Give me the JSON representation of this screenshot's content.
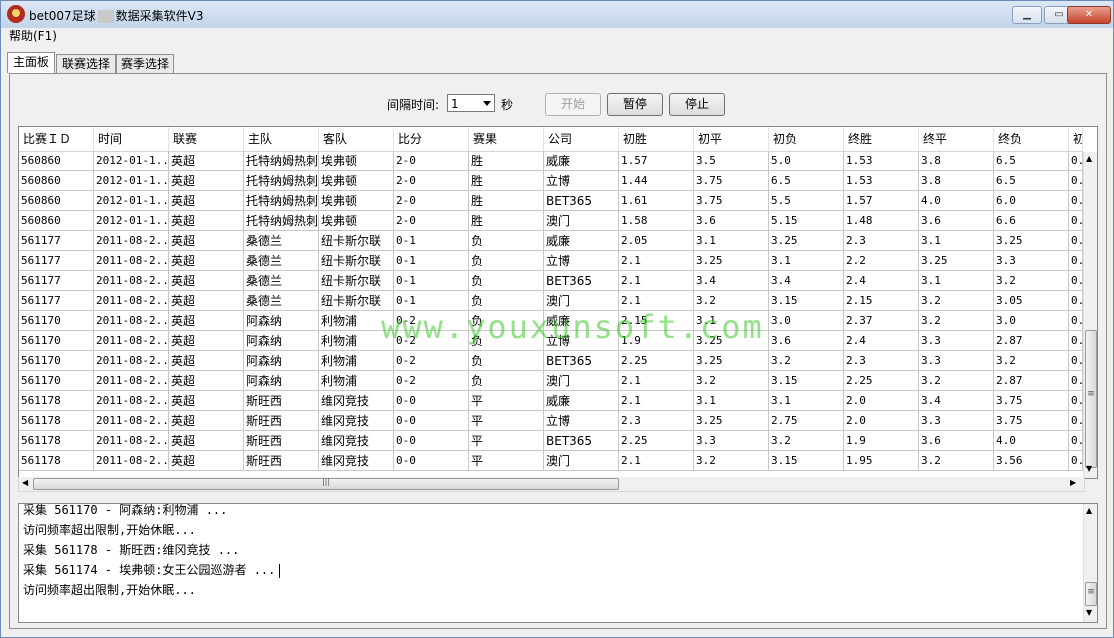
{
  "window": {
    "title_left": "bet007足球",
    "title_right": "数据采集软件V3",
    "btn_min": "▁",
    "btn_max": "▭",
    "btn_close": "✕"
  },
  "menu": {
    "help": "帮助(F1)"
  },
  "tabs": [
    {
      "label": "主面板",
      "active": true
    },
    {
      "label": "联赛选择",
      "active": false
    },
    {
      "label": "赛季选择",
      "active": false
    }
  ],
  "controls": {
    "interval_label": "间隔时间:",
    "interval_value": "1",
    "unit": "秒",
    "start": "开始",
    "pause": "暂停",
    "stop": "停止"
  },
  "table": {
    "columns": [
      "比赛ＩＤ",
      "时间",
      "联赛",
      "主队",
      "客队",
      "比分",
      "赛果",
      "公司",
      "初胜",
      "初平",
      "初负",
      "终胜",
      "终平",
      "终负",
      "初"
    ],
    "rows": [
      [
        "560860",
        "2012-01-1...",
        "英超",
        "托特纳姆热刺",
        "埃弗顿",
        "2-0",
        "胜",
        "威廉",
        "1.57",
        "3.5",
        "5.0",
        "1.53",
        "3.8",
        "6.5",
        "0."
      ],
      [
        "560860",
        "2012-01-1...",
        "英超",
        "托特纳姆热刺",
        "埃弗顿",
        "2-0",
        "胜",
        "立博",
        "1.44",
        "3.75",
        "6.5",
        "1.53",
        "3.8",
        "6.5",
        "0."
      ],
      [
        "560860",
        "2012-01-1...",
        "英超",
        "托特纳姆热刺",
        "埃弗顿",
        "2-0",
        "胜",
        "BET365",
        "1.61",
        "3.75",
        "5.5",
        "1.57",
        "4.0",
        "6.0",
        "0."
      ],
      [
        "560860",
        "2012-01-1...",
        "英超",
        "托特纳姆热刺",
        "埃弗顿",
        "2-0",
        "胜",
        "澳门",
        "1.58",
        "3.6",
        "5.15",
        "1.48",
        "3.6",
        "6.6",
        "0."
      ],
      [
        "561177",
        "2011-08-2...",
        "英超",
        "桑德兰",
        "纽卡斯尔联",
        "0-1",
        "负",
        "威廉",
        "2.05",
        "3.1",
        "3.25",
        "2.3",
        "3.1",
        "3.25",
        "0."
      ],
      [
        "561177",
        "2011-08-2...",
        "英超",
        "桑德兰",
        "纽卡斯尔联",
        "0-1",
        "负",
        "立博",
        "2.1",
        "3.25",
        "3.1",
        "2.2",
        "3.25",
        "3.3",
        "0."
      ],
      [
        "561177",
        "2011-08-2...",
        "英超",
        "桑德兰",
        "纽卡斯尔联",
        "0-1",
        "负",
        "BET365",
        "2.1",
        "3.4",
        "3.4",
        "2.4",
        "3.1",
        "3.2",
        "0."
      ],
      [
        "561177",
        "2011-08-2...",
        "英超",
        "桑德兰",
        "纽卡斯尔联",
        "0-1",
        "负",
        "澳门",
        "2.1",
        "3.2",
        "3.15",
        "2.15",
        "3.2",
        "3.05",
        "0."
      ],
      [
        "561170",
        "2011-08-2...",
        "英超",
        "阿森纳",
        "利物浦",
        "0-2",
        "负",
        "威廉",
        "2.15",
        "3.1",
        "3.0",
        "2.37",
        "3.2",
        "3.0",
        "0."
      ],
      [
        "561170",
        "2011-08-2...",
        "英超",
        "阿森纳",
        "利物浦",
        "0-2",
        "负",
        "立博",
        "1.9",
        "3.25",
        "3.6",
        "2.4",
        "3.3",
        "2.87",
        "0."
      ],
      [
        "561170",
        "2011-08-2...",
        "英超",
        "阿森纳",
        "利物浦",
        "0-2",
        "负",
        "BET365",
        "2.25",
        "3.25",
        "3.2",
        "2.3",
        "3.3",
        "3.2",
        "0."
      ],
      [
        "561170",
        "2011-08-2...",
        "英超",
        "阿森纳",
        "利物浦",
        "0-2",
        "负",
        "澳门",
        "2.1",
        "3.2",
        "3.15",
        "2.25",
        "3.2",
        "2.87",
        "0."
      ],
      [
        "561178",
        "2011-08-2...",
        "英超",
        "斯旺西",
        "维冈竞技",
        "0-0",
        "平",
        "威廉",
        "2.1",
        "3.1",
        "3.1",
        "2.0",
        "3.4",
        "3.75",
        "0."
      ],
      [
        "561178",
        "2011-08-2...",
        "英超",
        "斯旺西",
        "维冈竞技",
        "0-0",
        "平",
        "立博",
        "2.3",
        "3.25",
        "2.75",
        "2.0",
        "3.3",
        "3.75",
        "0."
      ],
      [
        "561178",
        "2011-08-2...",
        "英超",
        "斯旺西",
        "维冈竞技",
        "0-0",
        "平",
        "BET365",
        "2.25",
        "3.3",
        "3.2",
        "1.9",
        "3.6",
        "4.0",
        "0."
      ],
      [
        "561178",
        "2011-08-2...",
        "英超",
        "斯旺西",
        "维冈竞技",
        "0-0",
        "平",
        "澳门",
        "2.1",
        "3.2",
        "3.15",
        "1.95",
        "3.2",
        "3.56",
        "0."
      ]
    ]
  },
  "log": [
    "采集 561170 - 阿森纳:利物浦 ...",
    "访问频率超出限制,开始休眠...",
    "采集 561178 - 斯旺西:维冈竞技 ...",
    "采集 561174 - 埃弗顿:女王公园巡游者 ...",
    "访问频率超出限制,开始休眠..."
  ],
  "watermark": "www.youxunsoft.com",
  "scroll_icons": {
    "up": "▲",
    "down": "▼",
    "left": "◀",
    "right": "▶",
    "grip_v": "≡",
    "grip_h": "|||"
  }
}
